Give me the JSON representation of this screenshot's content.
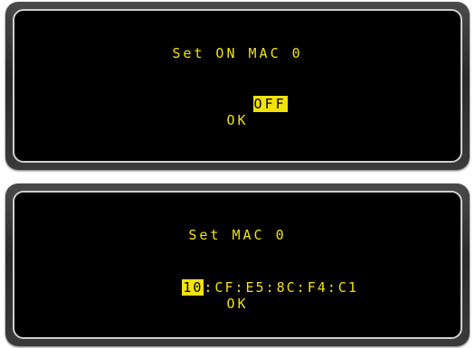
{
  "screen1": {
    "title": "Set ON MAC 0",
    "value": "OFF",
    "ok_label": "OK"
  },
  "screen2": {
    "title": "Set MAC 0",
    "mac_octets": [
      "10",
      "CF",
      "E5",
      "8C",
      "F4",
      "C1"
    ],
    "separator": ":",
    "ok_label": "OK"
  },
  "colors": {
    "text": "#f3e20a",
    "screen_bg": "#000000",
    "highlight_bg": "#f3e20a"
  }
}
